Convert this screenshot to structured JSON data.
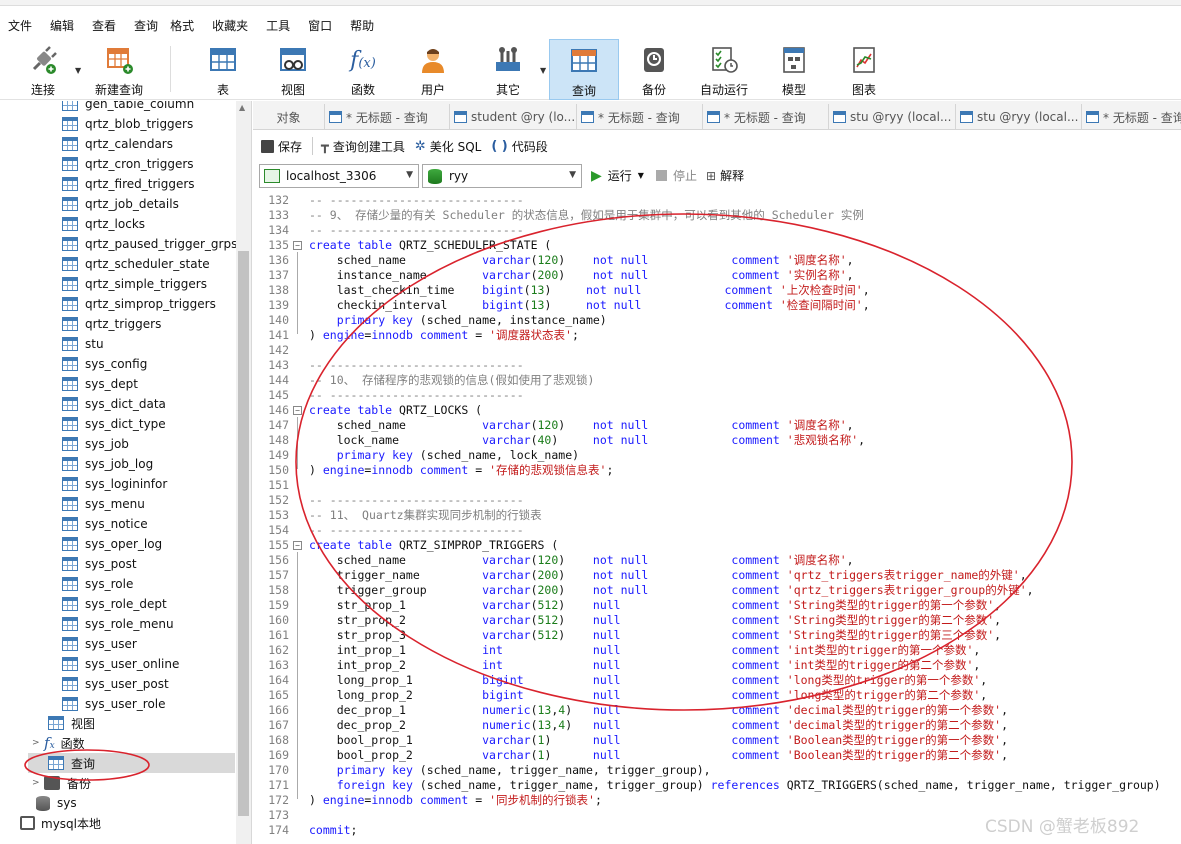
{
  "menu": [
    "文件",
    "编辑",
    "查看",
    "查询",
    "格式",
    "收藏夹",
    "工具",
    "窗口",
    "帮助"
  ],
  "toolbar": {
    "connect": "连接",
    "new_query": "新建查询",
    "table": "表",
    "view": "视图",
    "function": "函数",
    "user": "用户",
    "other": "其它",
    "query": "查询",
    "backup": "备份",
    "auto_run": "自动运行",
    "model": "模型",
    "chart": "图表"
  },
  "sidebar": {
    "tables": [
      "gen_table_column",
      "qrtz_blob_triggers",
      "qrtz_calendars",
      "qrtz_cron_triggers",
      "qrtz_fired_triggers",
      "qrtz_job_details",
      "qrtz_locks",
      "qrtz_paused_trigger_grps",
      "qrtz_scheduler_state",
      "qrtz_simple_triggers",
      "qrtz_simprop_triggers",
      "qrtz_triggers",
      "stu",
      "sys_config",
      "sys_dept",
      "sys_dict_data",
      "sys_dict_type",
      "sys_job",
      "sys_job_log",
      "sys_logininfor",
      "sys_menu",
      "sys_notice",
      "sys_oper_log",
      "sys_post",
      "sys_role",
      "sys_role_dept",
      "sys_role_menu",
      "sys_user",
      "sys_user_online",
      "sys_user_post",
      "sys_user_role"
    ],
    "views_label": "视图",
    "functions_label": "函数",
    "queries_label": "查询",
    "backup_label": "备份",
    "db_sys": "sys",
    "conn_local": "mysql本地"
  },
  "tabs": [
    "对象",
    "* 无标题 - 查询",
    "student @ry (lo...",
    "* 无标题 - 查询",
    "* 无标题 - 查询",
    "stu @ryy (local...",
    "stu @ryy (local...",
    "* 无标题 - 查询"
  ],
  "editor_toolbar": {
    "save": "保存",
    "query_builder": "查询创建工具",
    "beautify": "美化 SQL",
    "snippet": "代码段"
  },
  "connection": {
    "server": "localhost_3306",
    "database": "ryy",
    "run": "运行",
    "stop": "停止",
    "explain": "解释"
  },
  "code": [
    {
      "n": "132",
      "t": "-- ----------------------------",
      "cls": "c"
    },
    {
      "n": "133",
      "t": "-- 9、 存储少量的有关 Scheduler 的状态信息，假如是用于集群中，可以看到其他的 Scheduler 实例",
      "cls": "c"
    },
    {
      "n": "134",
      "t": "-- ----------------------------",
      "cls": "c"
    },
    {
      "n": "135",
      "fold": true,
      "segs": [
        [
          "create table",
          "k"
        ],
        [
          " QRTZ_SCHEDULER_STATE (",
          ""
        ]
      ]
    },
    {
      "n": "136",
      "segs": [
        [
          "    sched_name           ",
          ""
        ],
        [
          "varchar",
          "k"
        ],
        [
          "(",
          ""
        ],
        [
          "120",
          "t"
        ],
        [
          ")    ",
          ""
        ],
        [
          "not null",
          "k"
        ],
        [
          "            ",
          ""
        ],
        [
          "comment",
          "k"
        ],
        [
          " ",
          ""
        ],
        [
          "'调度名称'",
          "s"
        ],
        [
          ",",
          ""
        ]
      ]
    },
    {
      "n": "137",
      "segs": [
        [
          "    instance_name        ",
          ""
        ],
        [
          "varchar",
          "k"
        ],
        [
          "(",
          ""
        ],
        [
          "200",
          "t"
        ],
        [
          ")    ",
          ""
        ],
        [
          "not null",
          "k"
        ],
        [
          "            ",
          ""
        ],
        [
          "comment",
          "k"
        ],
        [
          " ",
          ""
        ],
        [
          "'实例名称'",
          "s"
        ],
        [
          ",",
          ""
        ]
      ]
    },
    {
      "n": "138",
      "segs": [
        [
          "    last_checkin_time    ",
          ""
        ],
        [
          "bigint",
          "k"
        ],
        [
          "(",
          ""
        ],
        [
          "13",
          "t"
        ],
        [
          ")     ",
          ""
        ],
        [
          "not null",
          "k"
        ],
        [
          "            ",
          ""
        ],
        [
          "comment",
          "k"
        ],
        [
          " ",
          ""
        ],
        [
          "'上次检查时间'",
          "s"
        ],
        [
          ",",
          ""
        ]
      ]
    },
    {
      "n": "139",
      "segs": [
        [
          "    checkin_interval     ",
          ""
        ],
        [
          "bigint",
          "k"
        ],
        [
          "(",
          ""
        ],
        [
          "13",
          "t"
        ],
        [
          ")     ",
          ""
        ],
        [
          "not null",
          "k"
        ],
        [
          "            ",
          ""
        ],
        [
          "comment",
          "k"
        ],
        [
          " ",
          ""
        ],
        [
          "'检查间隔时间'",
          "s"
        ],
        [
          ",",
          ""
        ]
      ]
    },
    {
      "n": "140",
      "segs": [
        [
          "    ",
          ""
        ],
        [
          "primary key",
          "k"
        ],
        [
          " (sched_name, instance_name)",
          ""
        ]
      ]
    },
    {
      "n": "141",
      "end": true,
      "segs": [
        [
          ") ",
          ""
        ],
        [
          "engine",
          "k"
        ],
        [
          "=",
          ""
        ],
        [
          "innodb",
          "k"
        ],
        [
          " ",
          ""
        ],
        [
          "comment",
          "k"
        ],
        [
          " = ",
          ""
        ],
        [
          "'调度器状态表'",
          "s"
        ],
        [
          ";",
          ""
        ]
      ]
    },
    {
      "n": "142",
      "segs": []
    },
    {
      "n": "143",
      "t": "-- ----------------------------",
      "cls": "c"
    },
    {
      "n": "144",
      "t": "-- 10、 存储程序的悲观锁的信息(假如使用了悲观锁)",
      "cls": "c"
    },
    {
      "n": "145",
      "t": "-- ----------------------------",
      "cls": "c"
    },
    {
      "n": "146",
      "fold": true,
      "segs": [
        [
          "create table",
          "k"
        ],
        [
          " QRTZ_LOCKS (",
          ""
        ]
      ]
    },
    {
      "n": "147",
      "segs": [
        [
          "    sched_name           ",
          ""
        ],
        [
          "varchar",
          "k"
        ],
        [
          "(",
          ""
        ],
        [
          "120",
          "t"
        ],
        [
          ")    ",
          ""
        ],
        [
          "not null",
          "k"
        ],
        [
          "            ",
          ""
        ],
        [
          "comment",
          "k"
        ],
        [
          " ",
          ""
        ],
        [
          "'调度名称'",
          "s"
        ],
        [
          ",",
          ""
        ]
      ]
    },
    {
      "n": "148",
      "segs": [
        [
          "    lock_name            ",
          ""
        ],
        [
          "varchar",
          "k"
        ],
        [
          "(",
          ""
        ],
        [
          "40",
          "t"
        ],
        [
          ")     ",
          ""
        ],
        [
          "not null",
          "k"
        ],
        [
          "            ",
          ""
        ],
        [
          "comment",
          "k"
        ],
        [
          " ",
          ""
        ],
        [
          "'悲观锁名称'",
          "s"
        ],
        [
          ",",
          ""
        ]
      ]
    },
    {
      "n": "149",
      "segs": [
        [
          "    ",
          ""
        ],
        [
          "primary key",
          "k"
        ],
        [
          " (sched_name, lock_name)",
          ""
        ]
      ]
    },
    {
      "n": "150",
      "end": true,
      "segs": [
        [
          ") ",
          ""
        ],
        [
          "engine",
          "k"
        ],
        [
          "=",
          ""
        ],
        [
          "innodb",
          "k"
        ],
        [
          " ",
          ""
        ],
        [
          "comment",
          "k"
        ],
        [
          " = ",
          ""
        ],
        [
          "'存储的悲观锁信息表'",
          "s"
        ],
        [
          ";",
          ""
        ]
      ]
    },
    {
      "n": "151",
      "segs": []
    },
    {
      "n": "152",
      "t": "-- ----------------------------",
      "cls": "c"
    },
    {
      "n": "153",
      "t": "-- 11、 Quartz集群实现同步机制的行锁表",
      "cls": "c"
    },
    {
      "n": "154",
      "t": "-- ----------------------------",
      "cls": "c"
    },
    {
      "n": "155",
      "fold": true,
      "segs": [
        [
          "create table",
          "k"
        ],
        [
          " QRTZ_SIMPROP_TRIGGERS (",
          ""
        ]
      ]
    },
    {
      "n": "156",
      "segs": [
        [
          "    sched_name           ",
          ""
        ],
        [
          "varchar",
          "k"
        ],
        [
          "(",
          ""
        ],
        [
          "120",
          "t"
        ],
        [
          ")    ",
          ""
        ],
        [
          "not null",
          "k"
        ],
        [
          "            ",
          ""
        ],
        [
          "comment",
          "k"
        ],
        [
          " ",
          ""
        ],
        [
          "'调度名称'",
          "s"
        ],
        [
          ",",
          ""
        ]
      ]
    },
    {
      "n": "157",
      "segs": [
        [
          "    trigger_name         ",
          ""
        ],
        [
          "varchar",
          "k"
        ],
        [
          "(",
          ""
        ],
        [
          "200",
          "t"
        ],
        [
          ")    ",
          ""
        ],
        [
          "not null",
          "k"
        ],
        [
          "            ",
          ""
        ],
        [
          "comment",
          "k"
        ],
        [
          " ",
          ""
        ],
        [
          "'qrtz_triggers表trigger_name的外键'",
          "s"
        ],
        [
          ",",
          ""
        ]
      ]
    },
    {
      "n": "158",
      "segs": [
        [
          "    trigger_group        ",
          ""
        ],
        [
          "varchar",
          "k"
        ],
        [
          "(",
          ""
        ],
        [
          "200",
          "t"
        ],
        [
          ")    ",
          ""
        ],
        [
          "not null",
          "k"
        ],
        [
          "            ",
          ""
        ],
        [
          "comment",
          "k"
        ],
        [
          " ",
          ""
        ],
        [
          "'qrtz_triggers表trigger_group的外键'",
          "s"
        ],
        [
          ",",
          ""
        ]
      ]
    },
    {
      "n": "159",
      "segs": [
        [
          "    str_prop_1           ",
          ""
        ],
        [
          "varchar",
          "k"
        ],
        [
          "(",
          ""
        ],
        [
          "512",
          "t"
        ],
        [
          ")    ",
          ""
        ],
        [
          "null",
          "k"
        ],
        [
          "                ",
          ""
        ],
        [
          "comment",
          "k"
        ],
        [
          " ",
          ""
        ],
        [
          "'String类型的trigger的第一个参数'",
          "s"
        ],
        [
          ",",
          ""
        ]
      ]
    },
    {
      "n": "160",
      "segs": [
        [
          "    str_prop_2           ",
          ""
        ],
        [
          "varchar",
          "k"
        ],
        [
          "(",
          ""
        ],
        [
          "512",
          "t"
        ],
        [
          ")    ",
          ""
        ],
        [
          "null",
          "k"
        ],
        [
          "                ",
          ""
        ],
        [
          "comment",
          "k"
        ],
        [
          " ",
          ""
        ],
        [
          "'String类型的trigger的第二个参数'",
          "s"
        ],
        [
          ",",
          ""
        ]
      ]
    },
    {
      "n": "161",
      "segs": [
        [
          "    str_prop_3           ",
          ""
        ],
        [
          "varchar",
          "k"
        ],
        [
          "(",
          ""
        ],
        [
          "512",
          "t"
        ],
        [
          ")    ",
          ""
        ],
        [
          "null",
          "k"
        ],
        [
          "                ",
          ""
        ],
        [
          "comment",
          "k"
        ],
        [
          " ",
          ""
        ],
        [
          "'String类型的trigger的第三个参数'",
          "s"
        ],
        [
          ",",
          ""
        ]
      ]
    },
    {
      "n": "162",
      "segs": [
        [
          "    int_prop_1           ",
          ""
        ],
        [
          "int",
          "k"
        ],
        [
          "             ",
          ""
        ],
        [
          "null",
          "k"
        ],
        [
          "                ",
          ""
        ],
        [
          "comment",
          "k"
        ],
        [
          " ",
          ""
        ],
        [
          "'int类型的trigger的第一个参数'",
          "s"
        ],
        [
          ",",
          ""
        ]
      ]
    },
    {
      "n": "163",
      "segs": [
        [
          "    int_prop_2           ",
          ""
        ],
        [
          "int",
          "k"
        ],
        [
          "             ",
          ""
        ],
        [
          "null",
          "k"
        ],
        [
          "                ",
          ""
        ],
        [
          "comment",
          "k"
        ],
        [
          " ",
          ""
        ],
        [
          "'int类型的trigger的第二个参数'",
          "s"
        ],
        [
          ",",
          ""
        ]
      ]
    },
    {
      "n": "164",
      "segs": [
        [
          "    long_prop_1          ",
          ""
        ],
        [
          "bigint",
          "k"
        ],
        [
          "          ",
          ""
        ],
        [
          "null",
          "k"
        ],
        [
          "                ",
          ""
        ],
        [
          "comment",
          "k"
        ],
        [
          " ",
          ""
        ],
        [
          "'long类型的trigger的第一个参数'",
          "s"
        ],
        [
          ",",
          ""
        ]
      ]
    },
    {
      "n": "165",
      "segs": [
        [
          "    long_prop_2          ",
          ""
        ],
        [
          "bigint",
          "k"
        ],
        [
          "          ",
          ""
        ],
        [
          "null",
          "k"
        ],
        [
          "                ",
          ""
        ],
        [
          "comment",
          "k"
        ],
        [
          " ",
          ""
        ],
        [
          "'long类型的trigger的第二个参数'",
          "s"
        ],
        [
          ",",
          ""
        ]
      ]
    },
    {
      "n": "166",
      "segs": [
        [
          "    dec_prop_1           ",
          ""
        ],
        [
          "numeric",
          "k"
        ],
        [
          "(",
          ""
        ],
        [
          "13",
          "t"
        ],
        [
          ",",
          ""
        ],
        [
          "4",
          "t"
        ],
        [
          ")   ",
          ""
        ],
        [
          "null",
          "k"
        ],
        [
          "                ",
          ""
        ],
        [
          "comment",
          "k"
        ],
        [
          " ",
          ""
        ],
        [
          "'decimal类型的trigger的第一个参数'",
          "s"
        ],
        [
          ",",
          ""
        ]
      ]
    },
    {
      "n": "167",
      "segs": [
        [
          "    dec_prop_2           ",
          ""
        ],
        [
          "numeric",
          "k"
        ],
        [
          "(",
          ""
        ],
        [
          "13",
          "t"
        ],
        [
          ",",
          ""
        ],
        [
          "4",
          "t"
        ],
        [
          ")   ",
          ""
        ],
        [
          "null",
          "k"
        ],
        [
          "                ",
          ""
        ],
        [
          "comment",
          "k"
        ],
        [
          " ",
          ""
        ],
        [
          "'decimal类型的trigger的第二个参数'",
          "s"
        ],
        [
          ",",
          ""
        ]
      ]
    },
    {
      "n": "168",
      "segs": [
        [
          "    bool_prop_1          ",
          ""
        ],
        [
          "varchar",
          "k"
        ],
        [
          "(",
          ""
        ],
        [
          "1",
          "t"
        ],
        [
          ")      ",
          ""
        ],
        [
          "null",
          "k"
        ],
        [
          "                ",
          ""
        ],
        [
          "comment",
          "k"
        ],
        [
          " ",
          ""
        ],
        [
          "'Boolean类型的trigger的第一个参数'",
          "s"
        ],
        [
          ",",
          ""
        ]
      ]
    },
    {
      "n": "169",
      "segs": [
        [
          "    bool_prop_2          ",
          ""
        ],
        [
          "varchar",
          "k"
        ],
        [
          "(",
          ""
        ],
        [
          "1",
          "t"
        ],
        [
          ")      ",
          ""
        ],
        [
          "null",
          "k"
        ],
        [
          "                ",
          ""
        ],
        [
          "comment",
          "k"
        ],
        [
          " ",
          ""
        ],
        [
          "'Boolean类型的trigger的第二个参数'",
          "s"
        ],
        [
          ",",
          ""
        ]
      ]
    },
    {
      "n": "170",
      "segs": [
        [
          "    ",
          ""
        ],
        [
          "primary key",
          "k"
        ],
        [
          " (sched_name, trigger_name, trigger_group),",
          ""
        ]
      ]
    },
    {
      "n": "171",
      "segs": [
        [
          "    ",
          ""
        ],
        [
          "foreign key",
          "k"
        ],
        [
          " (sched_name, trigger_name, trigger_group) ",
          ""
        ],
        [
          "references",
          "k"
        ],
        [
          " QRTZ_TRIGGERS(sched_name, trigger_name, trigger_group)",
          ""
        ]
      ]
    },
    {
      "n": "172",
      "end": true,
      "segs": [
        [
          ") ",
          ""
        ],
        [
          "engine",
          "k"
        ],
        [
          "=",
          ""
        ],
        [
          "innodb",
          "k"
        ],
        [
          " ",
          ""
        ],
        [
          "comment",
          "k"
        ],
        [
          " = ",
          ""
        ],
        [
          "'同步机制的行锁表'",
          "s"
        ],
        [
          ";",
          ""
        ]
      ]
    },
    {
      "n": "173",
      "segs": []
    },
    {
      "n": "174",
      "segs": [
        [
          "commit",
          "k"
        ],
        [
          ";",
          ""
        ]
      ]
    }
  ],
  "watermark": "CSDN @蟹老板892",
  "colors": {
    "keyword": "#1a1aff",
    "string": "#c21a1a",
    "comment": "#808080",
    "annotation": "#d9232d",
    "active_tool": "#cce4f7"
  }
}
